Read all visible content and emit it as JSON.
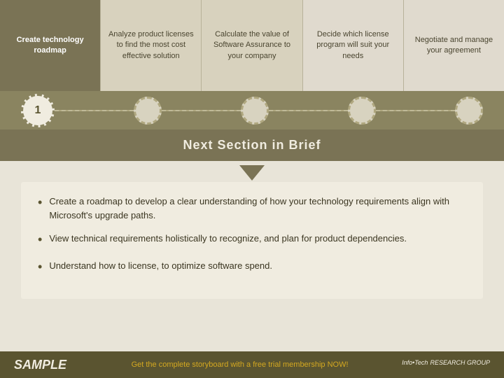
{
  "steps": [
    {
      "id": "step1",
      "label": "Create technology roadmap",
      "active": true
    },
    {
      "id": "step2",
      "label": "Analyze product licenses to find the most cost effective solution",
      "active": false
    },
    {
      "id": "step3",
      "label": "Calculate the value of Software Assurance to your company",
      "active": false
    },
    {
      "id": "step4",
      "label": "Decide which license program will suit your needs",
      "active": false
    },
    {
      "id": "step5",
      "label": "Negotiate and manage your agreement",
      "active": false
    }
  ],
  "circle_numbers": [
    "1",
    "",
    "",
    "",
    ""
  ],
  "next_section": {
    "title": "Next Section in Brief"
  },
  "bullets": [
    {
      "text": "Create a roadmap to develop a clear understanding of how your technology requirements align with Microsoft's upgrade paths."
    },
    {
      "text": "View technical requirements holistically to recognize, and plan for product dependencies."
    },
    {
      "text": "Understand how to license, to optimize software spend."
    }
  ],
  "footer": {
    "sample_label": "SAMPLE",
    "cta_text": "Get the complete storyboard with a free trial membership NOW!",
    "logo_text": "Info•Tech",
    "logo_sub": "RESEARCH GROUP"
  }
}
